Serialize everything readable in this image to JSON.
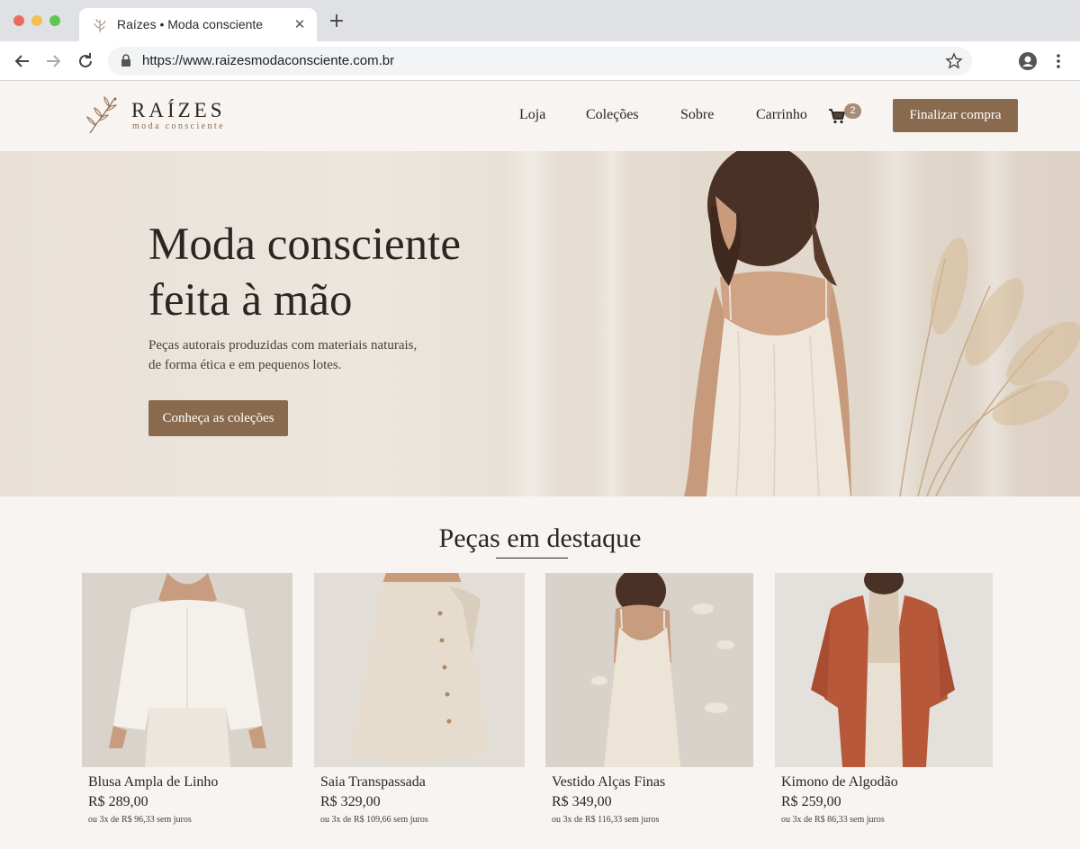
{
  "browser": {
    "tab_title": "Raízes • Moda consciente",
    "url": "https://www.raizesmodaconsciente.com.br"
  },
  "header": {
    "logo_name": "RAÍZES",
    "logo_tagline": "moda consciente",
    "menu": [
      {
        "label": "Loja"
      },
      {
        "label": "Coleções"
      },
      {
        "label": "Sobre"
      },
      {
        "label": "Carrinho"
      }
    ],
    "cart_count": "2",
    "checkout_label": "Finalizar compra"
  },
  "hero": {
    "title_line1": "Moda consciente",
    "title_line2": "feita à mão",
    "subtitle_line1": "Peças autorais produzidas com materiais naturais,",
    "subtitle_line2": "de forma ética e em pequenos lotes.",
    "cta_label": "Conheça as coleções"
  },
  "featured": {
    "title": "Peças em destaque",
    "products": [
      {
        "name": "Blusa Ampla de Linho",
        "price": "R$ 289,00",
        "installments": "ou 3x de R$ 96,33 sem juros"
      },
      {
        "name": "Saia Transpassada",
        "price": "R$ 329,00",
        "installments": "ou 3x de R$ 109,66 sem juros"
      },
      {
        "name": "Vestido Alças Finas",
        "price": "R$ 349,00",
        "installments": "ou 3x de R$ 116,33 sem juros"
      },
      {
        "name": "Kimono de Algodão",
        "price": "R$ 259,00",
        "installments": "ou 3x de R$ 86,33 sem juros"
      }
    ]
  },
  "colors": {
    "accent": "#8a6a4f",
    "background": "#f7f4f1",
    "text": "#2b2622",
    "kimono": "#b8583a"
  }
}
